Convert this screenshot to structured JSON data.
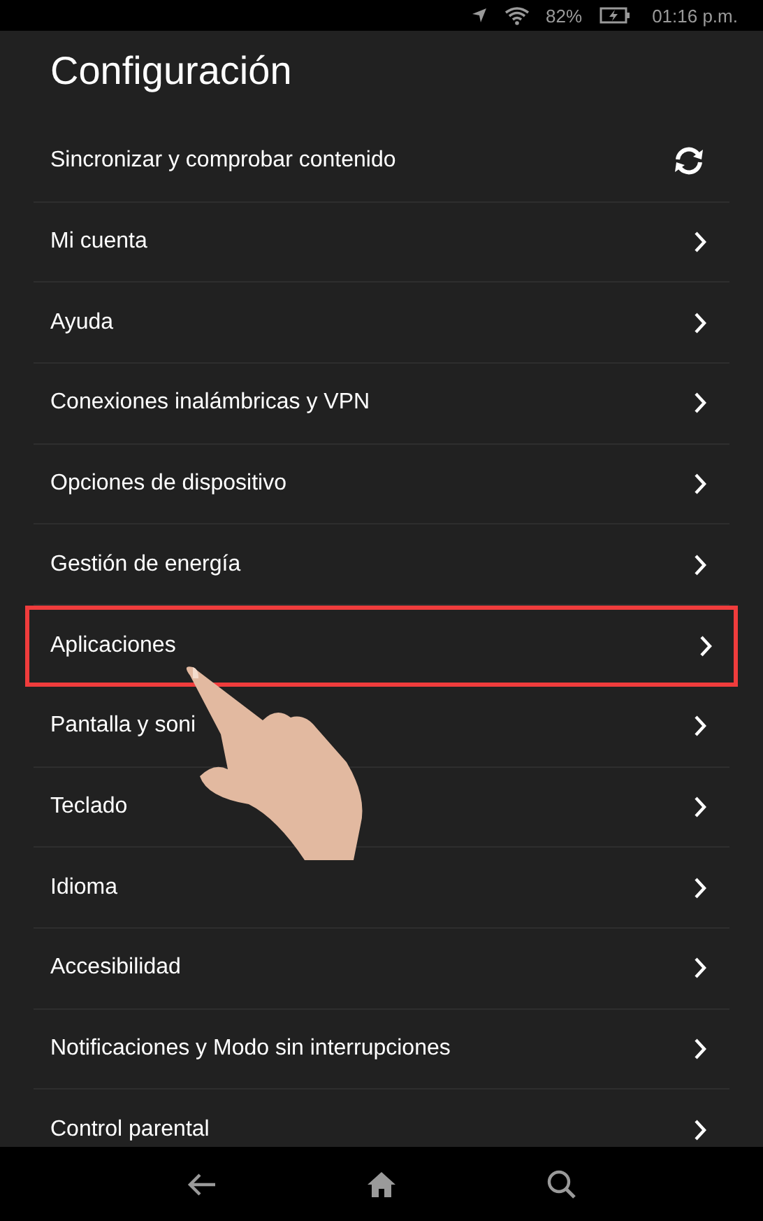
{
  "status_bar": {
    "battery": "82%",
    "time": "01:16 p.m."
  },
  "title": "Configuración",
  "rows": [
    {
      "label": "Sincronizar y comprobar contenido",
      "kind": "sync",
      "highlighted": false
    },
    {
      "label": "Mi cuenta",
      "kind": "chevron",
      "highlighted": false
    },
    {
      "label": "Ayuda",
      "kind": "chevron",
      "highlighted": false
    },
    {
      "label": "Conexiones inalámbricas y VPN",
      "kind": "chevron",
      "highlighted": false
    },
    {
      "label": "Opciones de dispositivo",
      "kind": "chevron",
      "highlighted": false
    },
    {
      "label": "Gestión de energía",
      "kind": "chevron",
      "highlighted": false
    },
    {
      "label": "Aplicaciones",
      "kind": "chevron",
      "highlighted": true
    },
    {
      "label": "Pantalla y soni",
      "kind": "chevron",
      "highlighted": false
    },
    {
      "label": "Teclado",
      "kind": "chevron",
      "highlighted": false
    },
    {
      "label": "Idioma",
      "kind": "chevron",
      "highlighted": false
    },
    {
      "label": "Accesibilidad",
      "kind": "chevron",
      "highlighted": false
    },
    {
      "label": "Notificaciones y Modo sin interrupciones",
      "kind": "chevron",
      "highlighted": false
    },
    {
      "label": "Control parental",
      "kind": "chevron",
      "highlighted": false
    }
  ]
}
